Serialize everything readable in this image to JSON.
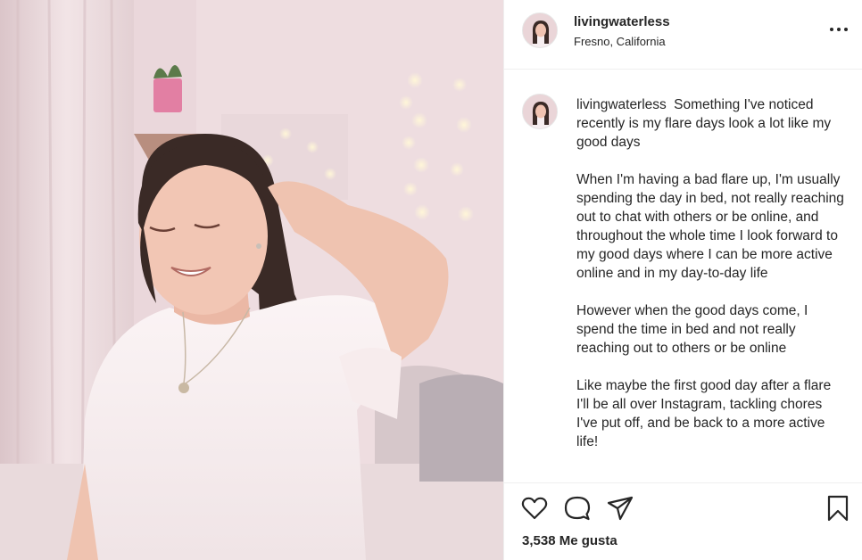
{
  "post": {
    "username": "livingwaterless",
    "location": "Fresno, California",
    "caption": {
      "username": "livingwaterless",
      "first_line": "Something I've noticed recently is my flare days look a lot like my good days",
      "paragraphs": [
        "When I'm having a bad flare up, I'm usually spending the day in bed, not really reaching out to chat with others or be online, and throughout the whole time I look forward to my good days where I can be more active online and in my day-to-day life",
        "However when the good days come, I spend the time in bed and not really reaching out to others or be online",
        "Like maybe the first good day after a flare I'll be all over Instagram, tackling chores I've put off, and be back to a more active life!"
      ]
    },
    "likes_text": "3,538 Me gusta"
  },
  "icons": {
    "more": "more-options-icon",
    "like": "heart-icon",
    "comment": "comment-icon",
    "share": "paper-plane-icon",
    "save": "bookmark-icon"
  },
  "colors": {
    "text": "#262626",
    "divider": "#efefef",
    "photo_tint": "#ecd6db"
  }
}
